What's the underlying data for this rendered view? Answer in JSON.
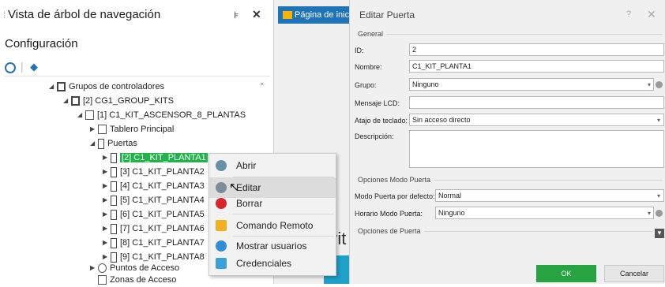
{
  "tree_panel": {
    "title": "Vista de árbol de navegación",
    "pin_glyph": "⊧",
    "close_glyph": "✕",
    "section_label": "Configuración",
    "toolbar_icons": [
      "refresh-icon",
      "navigate-icon"
    ],
    "nodes": [
      {
        "label": "Grupos de controladores"
      },
      {
        "label": "[2] CG1_GROUP_KITS"
      },
      {
        "label": "[1] C1_KIT_ASCENSOR_8_PLANTAS"
      },
      {
        "label": "Tablero Principal"
      },
      {
        "label": "Puertas"
      },
      {
        "label": "[2] C1_KIT_PLANTA1"
      },
      {
        "label": "[3] C1_KIT_PLANTA2"
      },
      {
        "label": "[4] C1_KIT_PLANTA3"
      },
      {
        "label": "[5] C1_KIT_PLANTA4"
      },
      {
        "label": "[6] C1_KIT_PLANTA5"
      },
      {
        "label": "[7] C1_KIT_PLANTA6"
      },
      {
        "label": "[8] C1_KIT_PLANTA7"
      },
      {
        "label": "[9] C1_KIT_PLANTA8"
      },
      {
        "label": "Puntos de Acceso"
      },
      {
        "label": "Zonas de Acceso"
      }
    ],
    "selected_color": "#22b24c"
  },
  "context_menu": {
    "items": [
      {
        "label": "Abrir",
        "icon": "open-icon",
        "color": "#6a8fa8"
      },
      {
        "label": "Editar",
        "icon": "edit-icon",
        "color": "#7b8d96"
      },
      {
        "label": "Borrar",
        "icon": "delete-icon",
        "color": "#d9262c"
      },
      {
        "label": "Comando Remoto",
        "icon": "remote-command-icon",
        "color": "#f2b01e"
      },
      {
        "label": "Mostrar usuarios",
        "icon": "users-icon",
        "color": "#2f8fd6"
      },
      {
        "label": "Credenciales",
        "icon": "credentials-icon",
        "color": "#3aa0d8"
      }
    ]
  },
  "mid": {
    "tab_label": "Página de inicio",
    "bg_text": "rit"
  },
  "dialog": {
    "title": "Editar Puerta",
    "help_glyph": "?",
    "close_glyph": "✕",
    "general_section": "General",
    "fields": {
      "id": {
        "label": "ID:",
        "value": "2"
      },
      "name": {
        "label": "Nombre:",
        "value": "C1_KIT_PLANTA1"
      },
      "group": {
        "label": "Grupo:",
        "value": "Ninguno"
      },
      "lcd": {
        "label": "Mensaje LCD:",
        "value": ""
      },
      "shortcut": {
        "label": "Atajo de teclado:",
        "value": "Sin acceso directo"
      },
      "description": {
        "label": "Descripción:",
        "value": ""
      }
    },
    "door_mode_section": "Opciones Modo Puerta",
    "default_mode": {
      "label": "Modo Puerta por defecto:",
      "value": "Normal"
    },
    "schedule": {
      "label": "Horario Modo Puerta:",
      "value": "Ninguno"
    },
    "door_options_section": "Opciones de Puerta",
    "ok_label": "OK",
    "cancel_label": "Cancelar",
    "ok_color": "#27a342"
  }
}
